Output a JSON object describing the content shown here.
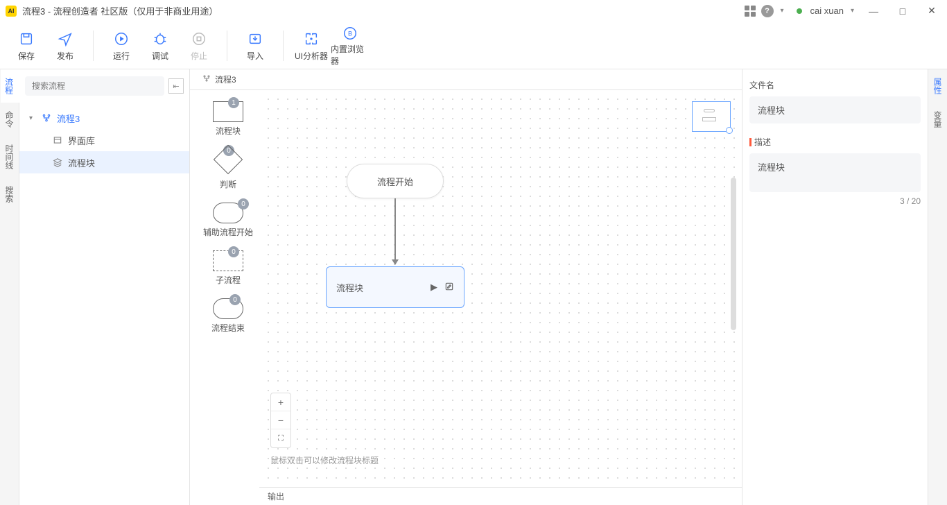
{
  "titlebar": {
    "title": "流程3 - 流程创造者 社区版（仅用于非商业用途）",
    "username": "cai xuan"
  },
  "toolbar": {
    "save": "保存",
    "publish": "发布",
    "run": "运行",
    "debug": "调试",
    "stop": "停止",
    "import": "导入",
    "analyzer": "UI分析器",
    "browser": "内置浏览器"
  },
  "left_rail": {
    "flow": "流程",
    "command": "命令",
    "timeline": "时间线",
    "search": "搜索"
  },
  "tree": {
    "search_placeholder": "搜索流程",
    "root": "流程3",
    "items": [
      {
        "label": "界面库"
      },
      {
        "label": "流程块"
      }
    ]
  },
  "tab": {
    "label": "流程3"
  },
  "palette": [
    {
      "label": "流程块",
      "badge": "1"
    },
    {
      "label": "判断",
      "badge": "0"
    },
    {
      "label": "辅助流程开始",
      "badge": "0"
    },
    {
      "label": "子流程",
      "badge": "0"
    },
    {
      "label": "流程结束",
      "badge": "0"
    }
  ],
  "canvas": {
    "start": "流程开始",
    "block": "流程块",
    "hint": "鼠标双击可以修改流程块标题"
  },
  "output": {
    "label": "输出"
  },
  "right_rail": {
    "props": "属性",
    "vars": "变量"
  },
  "props": {
    "filename_label": "文件名",
    "filename_value": "流程块",
    "desc_label": "描述",
    "desc_value": "流程块",
    "counter": "3 / 20"
  }
}
